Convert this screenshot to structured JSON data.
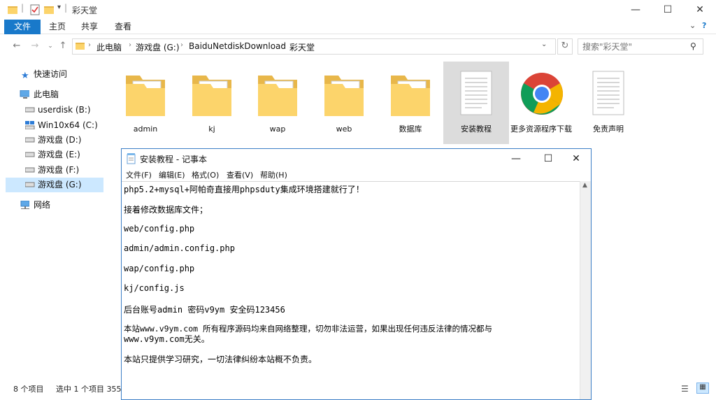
{
  "explorer": {
    "title": "彩天堂",
    "ribbon_tabs": [
      "文件",
      "主页",
      "共享",
      "查看"
    ],
    "address": {
      "crumbs": [
        "此电脑",
        "游戏盘 (G:)",
        "BaiduNetdiskDownload",
        "彩天堂"
      ]
    },
    "search": {
      "placeholder": "搜索\"彩天堂\""
    },
    "nav": {
      "quick_access": "快速访问",
      "this_pc": "此电脑",
      "drives": [
        "userdisk (B:)",
        "Win10x64 (C:)",
        "游戏盘 (D:)",
        "游戏盘 (E:)",
        "游戏盘 (F:)",
        "游戏盘 (G:)"
      ],
      "network": "网络"
    },
    "files": [
      {
        "name": "admin",
        "type": "folder"
      },
      {
        "name": "kj",
        "type": "folder"
      },
      {
        "name": "wap",
        "type": "folder"
      },
      {
        "name": "web",
        "type": "folder"
      },
      {
        "name": "数据库",
        "type": "folder"
      },
      {
        "name": "安装教程",
        "type": "text"
      },
      {
        "name": "更多资源程序下载",
        "type": "chrome"
      },
      {
        "name": "免责声明",
        "type": "text"
      }
    ],
    "status": {
      "count": "8 个项目",
      "selected": "选中 1 个项目 355"
    }
  },
  "notepad": {
    "title": "安装教程 - 记事本",
    "menu": [
      "文件(F)",
      "编辑(E)",
      "格式(O)",
      "查看(V)",
      "帮助(H)"
    ],
    "lines": [
      "php5.2+mysql+阿帕奇直接用phpsduty集成环境搭建就行了！",
      "接着修改数据库文件；",
      "web/config.php",
      "admin/admin.config.php",
      "wap/config.php",
      "kj/config.js",
      "后台账号admin 密码v9ym 安全码123456",
      "本站www.v9ym.com 所有程序源码均来自网络整理，切勿非法运营，如果出现任何违反法律的情况都与",
      "www.v9ym.com无关。",
      "本站只提供学习研究，一切法律纠纷本站概不负责。"
    ]
  }
}
